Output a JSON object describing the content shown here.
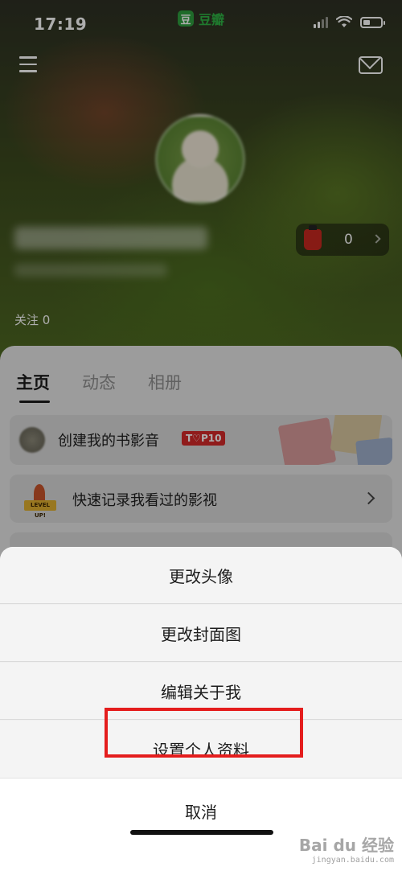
{
  "status_bar": {
    "time": "17:19",
    "app_logo_char": "豆",
    "app_name": "豆瓣"
  },
  "header": {
    "menu_icon": "hamburger-menu-icon",
    "mail_icon": "mail-icon"
  },
  "profile": {
    "follow_text": "关注 0",
    "gift_count": "0"
  },
  "tabs": [
    {
      "label": "主页",
      "active": true
    },
    {
      "label": "动态",
      "active": false
    },
    {
      "label": "相册",
      "active": false
    }
  ],
  "cards": {
    "book_film_music": {
      "label": "创建我的书影音",
      "badge": "T♡P10"
    },
    "quick_record": {
      "label": "快速记录我看过的影视",
      "icon_text": "LEVEL UP!"
    }
  },
  "action_sheet": {
    "options": [
      "更改头像",
      "更改封面图",
      "编辑关于我",
      "设置个人资料"
    ],
    "cancel": "取消",
    "highlight_color": "#e41d1d"
  },
  "watermark": {
    "main": "Bai du 经验",
    "sub": "jingyan.baidu.com"
  }
}
